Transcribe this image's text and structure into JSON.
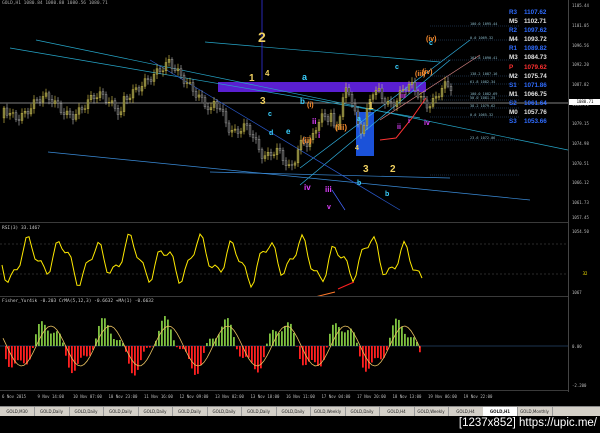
{
  "window": {
    "title": "GOLD,H1 1080.84 1080.88 1080.56 1080.71",
    "watermark": "[1237x852] https://upic.me/"
  },
  "price_axis": {
    "labels": [
      "1105.44",
      "1101.05",
      "1096.56",
      "1092.20",
      "1087.82",
      "1083.51",
      "1079.15",
      "1074.98",
      "1070.51",
      "1066.12",
      "1061.73",
      "1057.45"
    ],
    "current_price": "1080.71",
    "rsi_labels": [
      "1054.50",
      "1067"
    ],
    "rsi_tag": "32",
    "fisher_labels": [
      "0.00",
      "-2.200"
    ]
  },
  "pivot_levels": [
    {
      "key": "R3",
      "value": "1107.62",
      "color": "#2f6cff"
    },
    {
      "key": "M5",
      "value": "1102.71",
      "color": "#e0e0e0"
    },
    {
      "key": "R2",
      "value": "1097.62",
      "color": "#2f6cff"
    },
    {
      "key": "M4",
      "value": "1093.72",
      "color": "#e0e0e0"
    },
    {
      "key": "R1",
      "value": "1089.82",
      "color": "#2f6cff"
    },
    {
      "key": "M3",
      "value": "1084.73",
      "color": "#e0e0e0"
    },
    {
      "key": "P",
      "value": "1079.62",
      "color": "#ff3030"
    },
    {
      "key": "M2",
      "value": "1075.74",
      "color": "#e0e0e0"
    },
    {
      "key": "S1",
      "value": "1071.86",
      "color": "#2f6cff"
    },
    {
      "key": "M1",
      "value": "1066.75",
      "color": "#e0e0e0"
    },
    {
      "key": "S2",
      "value": "1061.64",
      "color": "#2f6cff"
    },
    {
      "key": "M0",
      "value": "1057.76",
      "color": "#e0e0e0"
    },
    {
      "key": "S3",
      "value": "1053.66",
      "color": "#2f6cff"
    }
  ],
  "indicators": {
    "rsi_title": "RSI(3) 33.1467",
    "fisher_title": "Fisher_Yur4ik -0.203  CrMA(5,12,3) -0.6632  +MA(1) -0.6632"
  },
  "wave_labels": [
    {
      "text": "2",
      "color": "#f0d060"
    },
    {
      "text": "1",
      "color": "#f0d060"
    },
    {
      "text": "3",
      "color": "#f0d060"
    },
    {
      "text": "4",
      "color": "#f0d060"
    },
    {
      "text": "a",
      "color": "#3ad0ff"
    },
    {
      "text": "c",
      "color": "#3ad0ff"
    },
    {
      "text": "e",
      "color": "#3ad0ff"
    },
    {
      "text": "b",
      "color": "#3ad0ff"
    },
    {
      "text": "d",
      "color": "#3ad0ff"
    },
    {
      "text": "(i)",
      "color": "#ff9030"
    },
    {
      "text": "(ii)",
      "color": "#ff9030"
    },
    {
      "text": "i",
      "color": "#e040ff"
    },
    {
      "text": "ii",
      "color": "#e040ff"
    },
    {
      "text": "iv",
      "color": "#e040ff"
    },
    {
      "text": "iii",
      "color": "#e040ff"
    },
    {
      "text": "v",
      "color": "#e040ff"
    },
    {
      "text": "(iii)",
      "color": "#ff9030"
    },
    {
      "text": "1",
      "color": "#f0d060"
    },
    {
      "text": "3",
      "color": "#f0d060"
    },
    {
      "text": "2",
      "color": "#f0d060"
    },
    {
      "text": "4",
      "color": "#f0d060"
    },
    {
      "text": "a",
      "color": "#3ad0ff"
    },
    {
      "text": "b",
      "color": "#3ad0ff"
    },
    {
      "text": "c",
      "color": "#3ad0ff"
    },
    {
      "text": "(iii)",
      "color": "#ff9030"
    },
    {
      "text": "iii",
      "color": "#e040ff"
    },
    {
      "text": "i",
      "color": "#e040ff"
    },
    {
      "text": "ii",
      "color": "#e040ff"
    },
    {
      "text": "(iv)",
      "color": "#ff9030"
    },
    {
      "text": "iv",
      "color": "#e040ff"
    },
    {
      "text": "(iv)",
      "color": "#ff9030"
    },
    {
      "text": "c",
      "color": "#3ad0ff"
    },
    {
      "text": "b",
      "color": "#3ad0ff"
    }
  ],
  "fib_labels": [
    "100.0 1095.44",
    "0.0 1069.32",
    "161.8 1090.41",
    "138.2 1087.16",
    "61.8 1082.34",
    "100.0 1082.69",
    "50.0 1081.25",
    "38.2 1079.62",
    "0.0 1065.32",
    "23.6 1072.06"
  ],
  "time_axis": [
    "6 Nov 2015",
    "9 Nov 14:00",
    "10 Nov 07:00",
    "10 Nov 23:00",
    "11 Nov 16:00",
    "12 Nov 09:00",
    "13 Nov 02:00",
    "13 Nov 18:00",
    "16 Nov 11:00",
    "17 Nov 04:00",
    "17 Nov 20:00",
    "18 Nov 13:00",
    "19 Nov 06:00",
    "19 Nov 22:00"
  ],
  "tabs": [
    "GOLD,M30",
    "GOLD,Daily",
    "GOLD,Daily",
    "GOLD,Daily",
    "GOLD,Daily",
    "GOLD,Daily",
    "GOLD,Daily",
    "GOLD,Daily",
    "GOLD,Daily",
    "GOLD,Weekly",
    "GOLD,Daily",
    "GOLD,H4",
    "GOLD,Weekly",
    "GOLD,H4",
    "GOLD,H1",
    "GOLD,Monthly"
  ],
  "active_tab_index": 14,
  "colors": {
    "bull": "#7fc241",
    "bear": "#ff2020",
    "rsi": "#ffea00",
    "zone": "#5a1fd1"
  }
}
